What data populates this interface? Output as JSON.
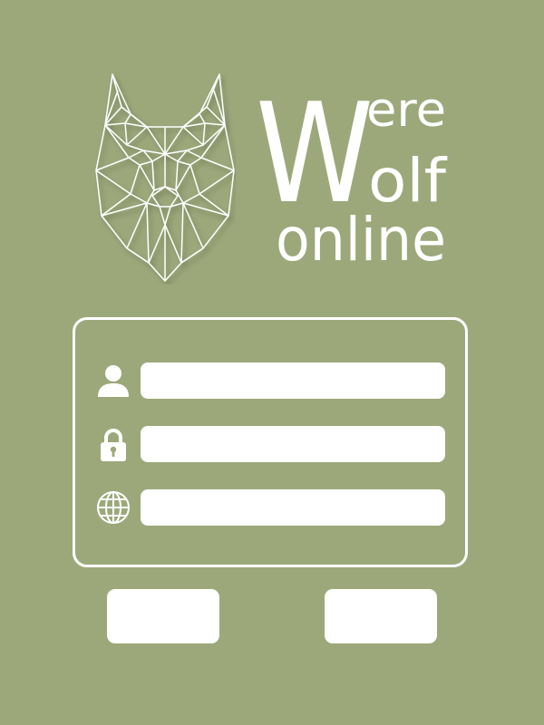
{
  "theme": {
    "background": "#9ca87a",
    "foreground": "#ffffff"
  },
  "logo": {
    "name": "WereWolf online",
    "line1_cap": "W",
    "line1_rest": "ere",
    "line2_rest": "olf",
    "line3": "online",
    "emblem": "wolf-head-icon"
  },
  "login_form": {
    "username": {
      "icon": "user-icon",
      "value": "",
      "placeholder": ""
    },
    "password": {
      "icon": "lock-icon",
      "value": "",
      "placeholder": ""
    },
    "server": {
      "icon": "globe-icon",
      "value": "",
      "placeholder": ""
    }
  },
  "buttons": {
    "left_label": "",
    "right_label": ""
  }
}
